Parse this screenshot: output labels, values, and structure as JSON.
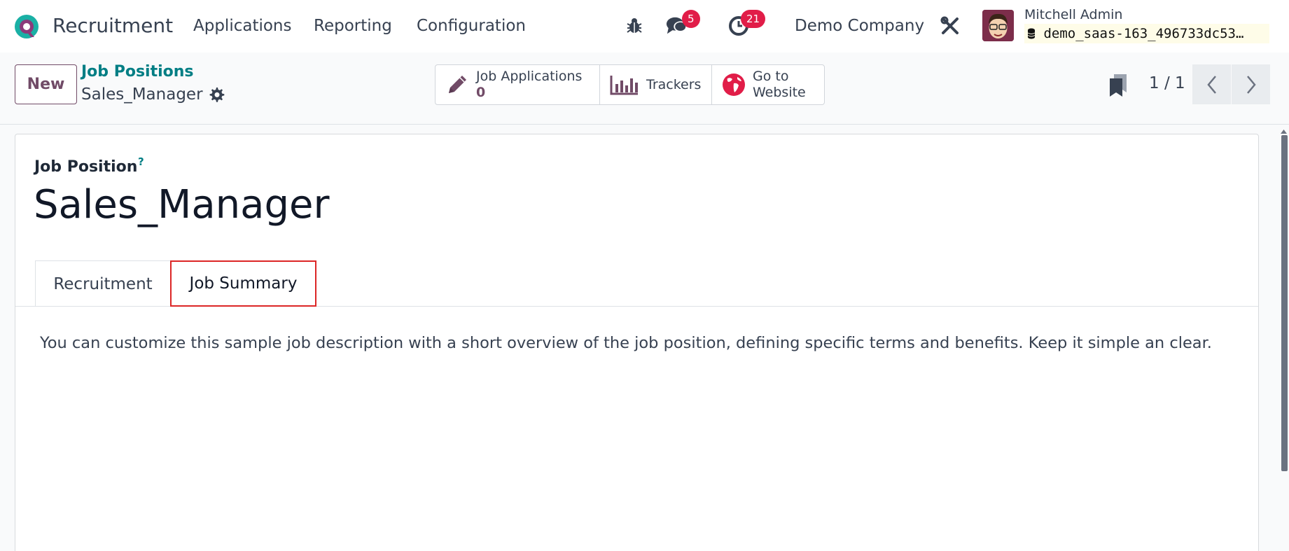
{
  "navbar": {
    "app_name": "Recruitment",
    "menu": [
      "Applications",
      "Reporting",
      "Configuration"
    ],
    "messages_badge": "5",
    "activities_badge": "21",
    "company": "Demo Company",
    "user_name": "Mitchell Admin",
    "database": "demo_saas-163_496733dc53…"
  },
  "control_panel": {
    "new_label": "New",
    "breadcrumb_parent": "Job Positions",
    "breadcrumb_current": "Sales_Manager",
    "smart_buttons": {
      "applications_label": "Job Applications",
      "applications_count": "0",
      "trackers_label": "Trackers",
      "website_label_1": "Go to",
      "website_label_2": "Website"
    },
    "pager": "1 / 1"
  },
  "form": {
    "field_label": "Job Position",
    "help": "?",
    "job_name": "Sales_Manager",
    "tabs": [
      "Recruitment",
      "Job Summary"
    ],
    "description": "You can customize this sample job description with a short overview of the job position, defining specific terms and benefits. Keep it simple an clear."
  },
  "colors": {
    "brand": "#714b67",
    "link": "#017e84",
    "badge": "#e11d48",
    "highlight": "#dc2626"
  }
}
